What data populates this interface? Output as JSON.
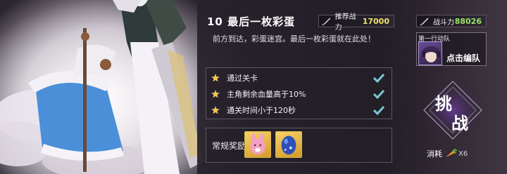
{
  "stage": {
    "title": "10 最后一枚彩蛋",
    "description": "前方到达，彩蛋迷宫。最后一枚彩蛋就在此处！"
  },
  "stats": {
    "recommended_label": "推荐战力",
    "recommended_value": "17000",
    "power_label": "战斗力",
    "power_value": "88026"
  },
  "team": {
    "label": "第一行动队",
    "action": "点击编队"
  },
  "objectives": [
    {
      "text": "通过关卡"
    },
    {
      "text": "主角剩余血量高于10%"
    },
    {
      "text": "通关时间小于120秒"
    }
  ],
  "rewards": {
    "label": "常规奖励",
    "items": [
      {
        "icon": "pink-rabbit-egg-icon"
      },
      {
        "icon": "blue-egg-icon"
      }
    ]
  },
  "challenge": {
    "char1": "挑",
    "char2": "战",
    "cost_label": "消耗",
    "cost_icon": "carrot-icon",
    "cost_qty": "X6"
  },
  "colors": {
    "recommended_value": "#f1e36b",
    "power_value": "#9be36a",
    "reward_frame": "#d9b54a"
  }
}
